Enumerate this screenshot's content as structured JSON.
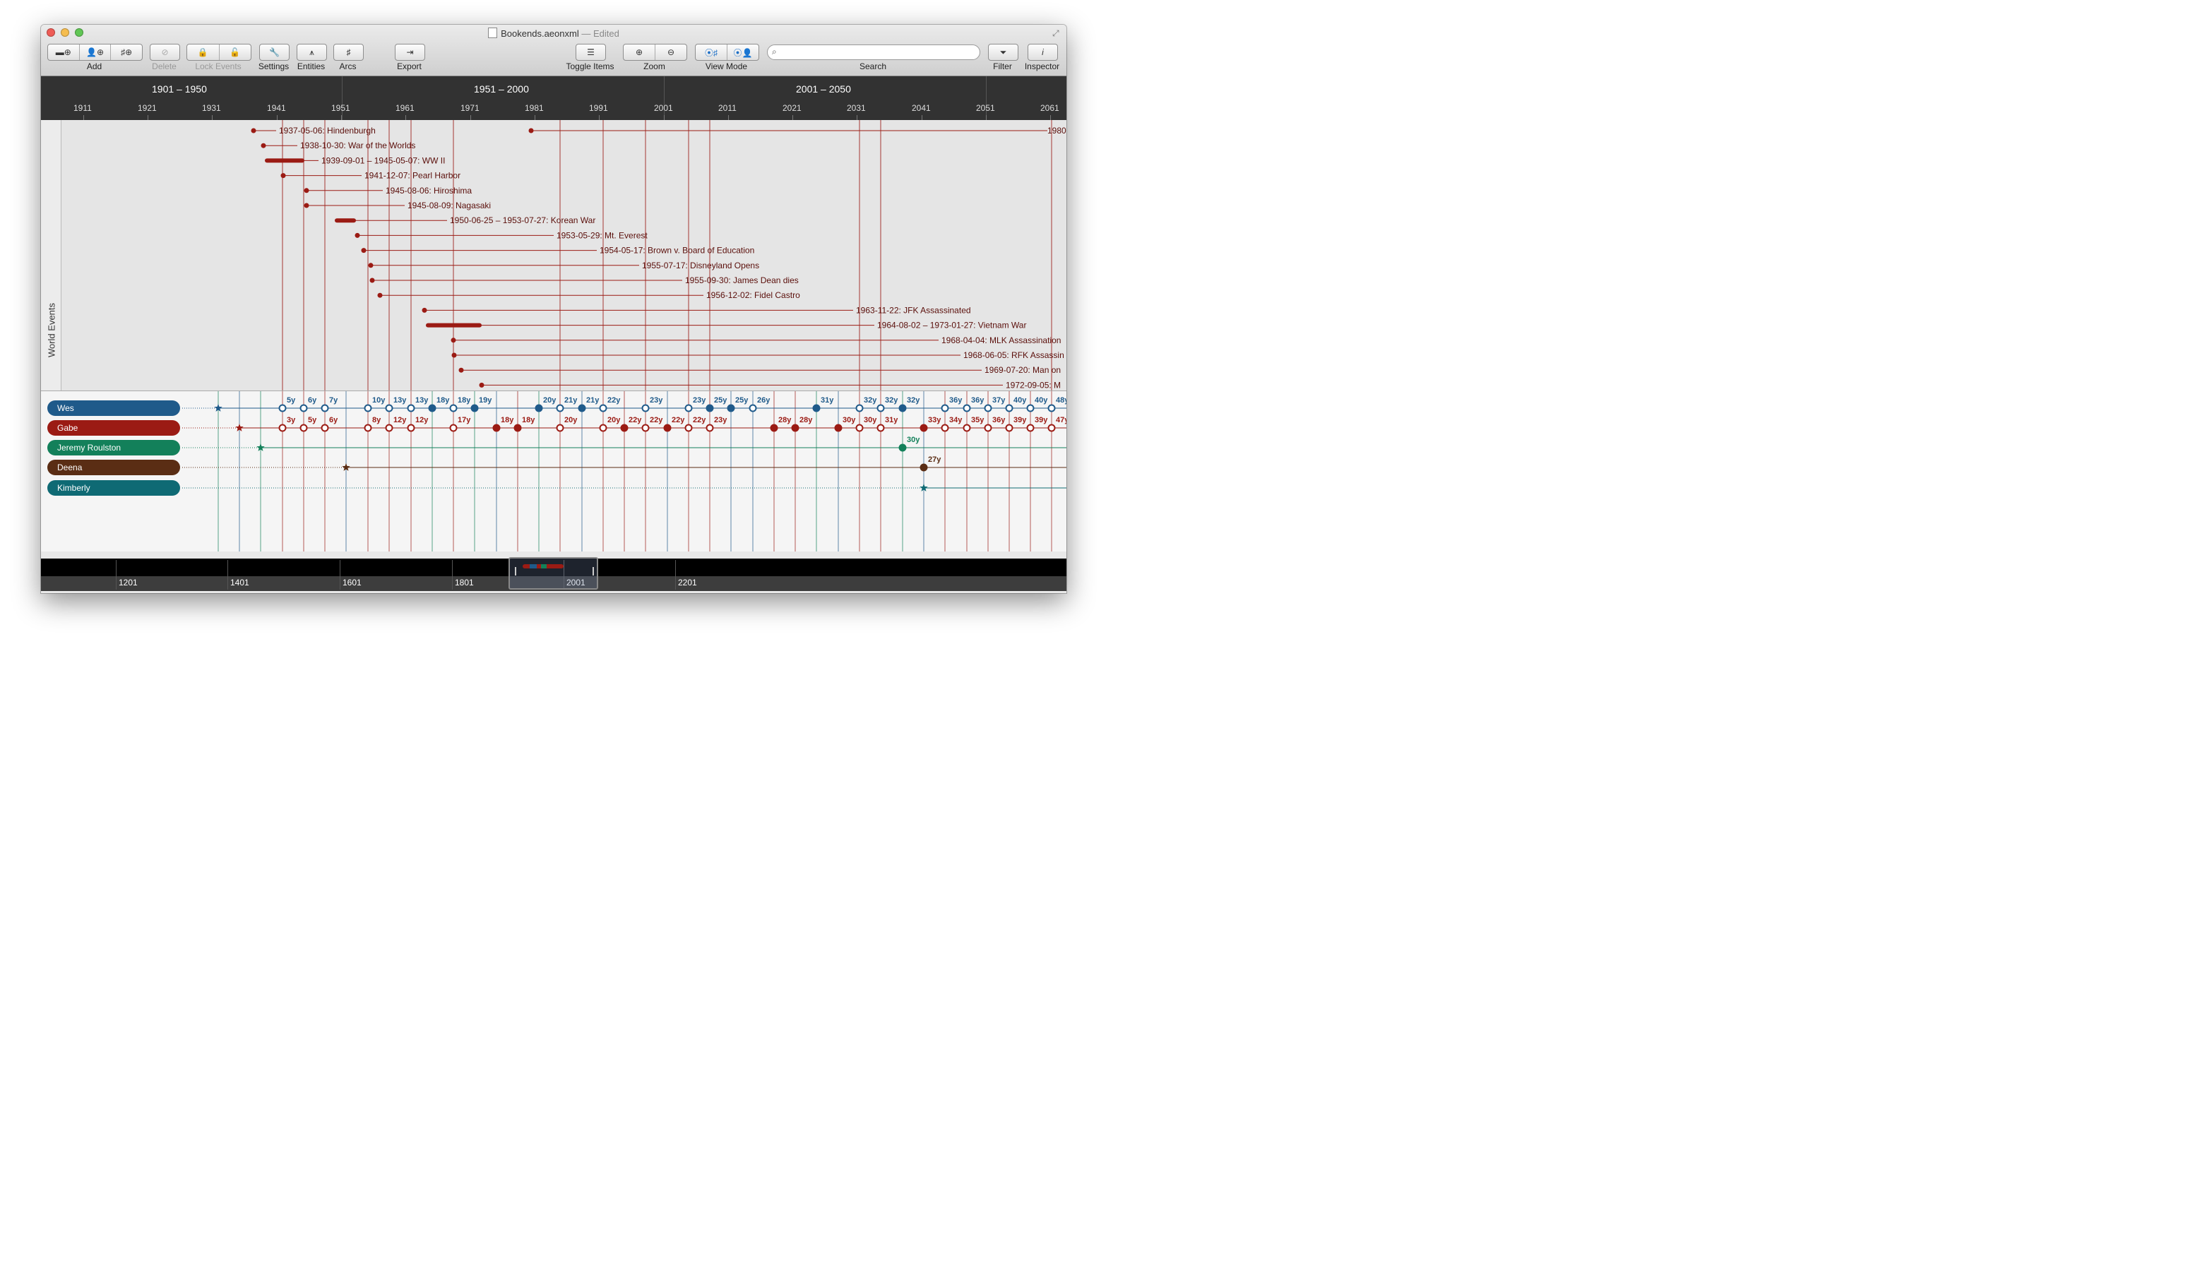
{
  "window": {
    "filename": "Bookends.aeonxml",
    "separator": "—",
    "status": "Edited"
  },
  "toolbar": {
    "add_label": "Add",
    "delete_label": "Delete",
    "lock_label": "Lock Events",
    "settings_label": "Settings",
    "entities_label": "Entities",
    "arcs_label": "Arcs",
    "export_label": "Export",
    "toggle_label": "Toggle Items",
    "zoom_label": "Zoom",
    "viewmode_label": "View Mode",
    "search_label": "Search",
    "search_placeholder": "",
    "filter_label": "Filter",
    "inspector_label": "Inspector"
  },
  "ruler": {
    "periods": [
      "1901 – 1950",
      "1951 – 2000",
      "2001 – 2050"
    ],
    "ticks": [
      "1911",
      "1921",
      "1931",
      "1941",
      "1951",
      "1961",
      "1971",
      "1981",
      "1991",
      "2001",
      "2011",
      "2021",
      "2031",
      "2041",
      "2051",
      "2061"
    ]
  },
  "events_lane_label": "World Events",
  "events": [
    {
      "label": "1937-05-06: Hindenburgh"
    },
    {
      "label": "1938-10-30: War of the Worlds"
    },
    {
      "label": "1939-09-01 – 1945-05-07: WW II"
    },
    {
      "label": "1941-12-07: Pearl Harbor"
    },
    {
      "label": "1945-08-06: Hiroshima"
    },
    {
      "label": "1945-08-09: Nagasaki"
    },
    {
      "label": "1950-06-25 – 1953-07-27: Korean War"
    },
    {
      "label": "1953-05-29: Mt. Everest"
    },
    {
      "label": "1954-05-17: Brown v. Board of Education"
    },
    {
      "label": "1955-07-17: Disneyland Opens"
    },
    {
      "label": "1955-09-30: James Dean dies"
    },
    {
      "label": "1956-12-02: Fidel Castro"
    },
    {
      "label": "1963-11-22: JFK Assassinated"
    },
    {
      "label": "1964-08-02 – 1973-01-27: Vietnam War"
    },
    {
      "label": "1968-04-04: MLK Assassination"
    },
    {
      "label": "1968-06-05: RFK Assassin"
    },
    {
      "label": "1969-07-20: Man on"
    },
    {
      "label": "1972-09-05: M"
    },
    {
      "label": "1980"
    }
  ],
  "entities": [
    {
      "name": "Wes",
      "color": "#1f5a8a"
    },
    {
      "name": "Gabe",
      "color": "#9b1b14"
    },
    {
      "name": "Jeremy Roulston",
      "color": "#13805a"
    },
    {
      "name": "Deena",
      "color": "#5a2d14"
    },
    {
      "name": "Kimberly",
      "color": "#0f6a74"
    }
  ],
  "ages": {
    "wes": [
      "5y",
      "6y",
      "7y",
      "10y",
      "13y",
      "13y",
      "18y",
      "18y",
      "19y",
      "20y",
      "21y",
      "21y",
      "22y",
      "23y",
      "23y",
      "25y",
      "25y",
      "26y",
      "31y",
      "32y",
      "32y",
      "32y",
      "36y",
      "36y",
      "37y",
      "40y",
      "40y",
      "48y"
    ],
    "gabe": [
      "3y",
      "5y",
      "6y",
      "8y",
      "12y",
      "12y",
      "17y",
      "18y",
      "18y",
      "20y",
      "20y",
      "22y",
      "22y",
      "22y",
      "22y",
      "23y",
      "28y",
      "28y",
      "30y",
      "30y",
      "31y",
      "33y",
      "34y",
      "35y",
      "36y",
      "39y",
      "39y",
      "47y"
    ],
    "jeremy": [
      "30y"
    ],
    "deena": [
      "27y"
    ]
  },
  "navigator": {
    "labels": [
      "1201",
      "1401",
      "1601",
      "1801",
      "2001",
      "2201"
    ]
  },
  "colors": {
    "event": "#9b1b14",
    "wes": "#1f5a8a",
    "gabe": "#9b1b14",
    "jeremy": "#13805a",
    "deena": "#5a2d14",
    "kimberly": "#0f6a74"
  }
}
